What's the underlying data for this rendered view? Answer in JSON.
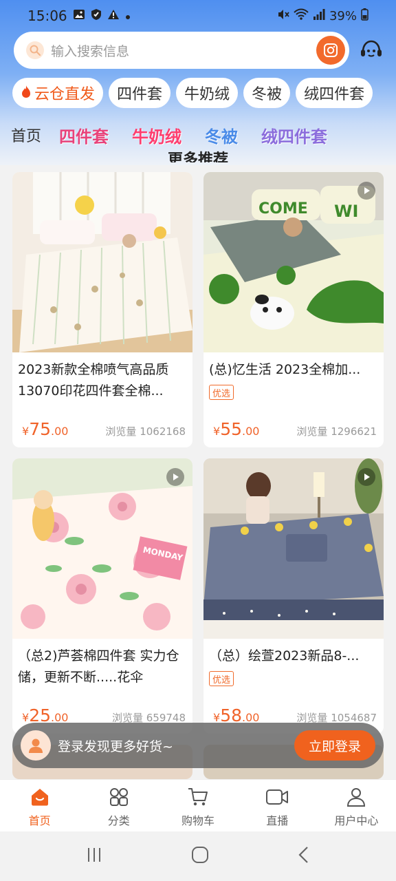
{
  "status_bar": {
    "time": "15:06",
    "battery": "39%"
  },
  "search": {
    "placeholder": "输入搜索信息"
  },
  "chips": [
    {
      "label": "云仓直发",
      "hot": true
    },
    {
      "label": "四件套"
    },
    {
      "label": "牛奶绒"
    },
    {
      "label": "冬被"
    },
    {
      "label": "绒四件套"
    }
  ],
  "category_tabs": {
    "home": "首页",
    "art": [
      "四件套",
      "牛奶绒",
      "冬被",
      "绒四件套"
    ]
  },
  "section_title": "更多推荐",
  "products": [
    {
      "title": "2023新款全棉喷气高品质13070印花四件套全棉...",
      "price_int": "75",
      "price_dec": ".00",
      "views": "浏览量 1062168",
      "badge": ""
    },
    {
      "title": "(总)忆生活 2023全棉加...",
      "price_int": "55",
      "price_dec": ".00",
      "views": "浏览量 1296621",
      "badge": "优选"
    },
    {
      "title": "（总2)芦荟棉四件套 实力仓储，更新不断.....花伞",
      "price_int": "25",
      "price_dec": ".00",
      "views": "浏览量 659748",
      "badge": ""
    },
    {
      "title": "（总）绘萱2023新品8-...",
      "price_int": "58",
      "price_dec": ".00",
      "views": "浏览量 1054687",
      "badge": "优选"
    }
  ],
  "price_symbol": "¥",
  "login_bar": {
    "text": "登录发现更多好货~",
    "button": "立即登录"
  },
  "bottom_nav": [
    {
      "label": "首页",
      "icon": "home-icon",
      "active": true
    },
    {
      "label": "分类",
      "icon": "category-icon"
    },
    {
      "label": "购物车",
      "icon": "cart-icon"
    },
    {
      "label": "直播",
      "icon": "live-icon"
    },
    {
      "label": "用户中心",
      "icon": "user-icon"
    }
  ],
  "colors": {
    "accent": "#f0621e",
    "price": "#f0632a",
    "header_blue": "#4f8ff0"
  }
}
